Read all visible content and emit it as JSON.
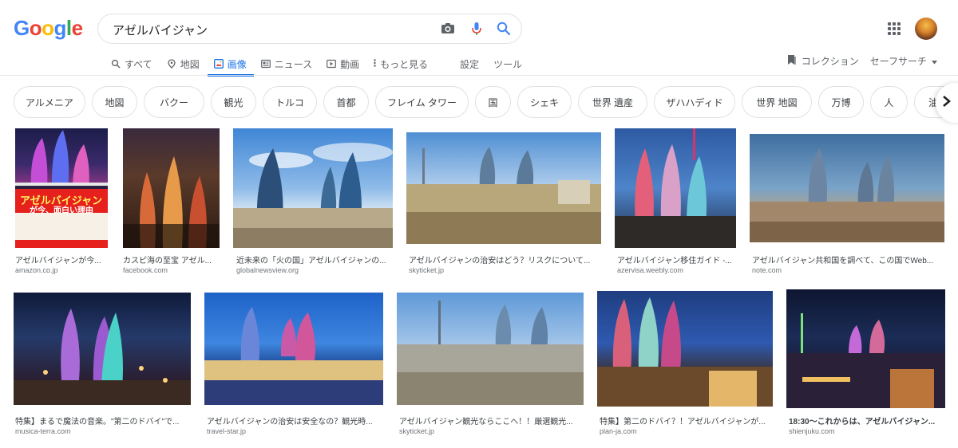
{
  "logo": {
    "letters": [
      "G",
      "o",
      "o",
      "g",
      "l",
      "e"
    ],
    "colors": [
      "#4285F4",
      "#EA4335",
      "#FBBC05",
      "#4285F4",
      "#34A853",
      "#EA4335"
    ]
  },
  "search": {
    "query": "アゼルバイジャン"
  },
  "tabs": [
    {
      "label": "すべて",
      "icon": "search-icon"
    },
    {
      "label": "地図",
      "icon": "map-pin-icon"
    },
    {
      "label": "画像",
      "icon": "image-icon",
      "active": true
    },
    {
      "label": "ニュース",
      "icon": "news-icon"
    },
    {
      "label": "動画",
      "icon": "video-icon"
    },
    {
      "label": "もっと見る",
      "icon": "more-vert-icon"
    },
    {
      "label": "設定"
    },
    {
      "label": "ツール"
    }
  ],
  "right_tools": {
    "collection": "コレクション",
    "safesearch": "セーフサーチ"
  },
  "chips": [
    "アルメニア",
    "地図",
    "バクー",
    "観光",
    "トルコ",
    "首都",
    "フレイム タワー",
    "国",
    "シェキ",
    "世界 遺産",
    "ザハハディド",
    "世界 地図",
    "万博",
    "人",
    "油田"
  ],
  "results": [
    {
      "caption": "アゼルバイジャンが今...",
      "source": "amazon.co.jp"
    },
    {
      "caption": "カスピ海の至宝 アゼル...",
      "source": "facebook.com"
    },
    {
      "caption": "近未来の「火の国」アゼルバイジャンの...",
      "source": "globalnewsview.org"
    },
    {
      "caption": "アゼルバイジャンの治安はどう？リスクについて...",
      "source": "skyticket.jp"
    },
    {
      "caption": "アゼルバイジャン移住ガイド -...",
      "source": "azervisa.weebly.com"
    },
    {
      "caption": "アゼルバイジャン共和国を調べて、この国でWeb...",
      "source": "note.com"
    },
    {
      "caption": "特集】まるで魔法の音楽。\"第二のドバイ\"で...",
      "source": "musica-terra.com"
    },
    {
      "caption": "アゼルバイジャンの治安は安全なの？観光時...",
      "source": "travel-star.jp"
    },
    {
      "caption": "アゼルバイジャン観光ならここへ！！厳選観光...",
      "source": "skyticket.jp"
    },
    {
      "caption": "特集】第二のドバイ？！アゼルバイジャンが...",
      "source": "plan-ja.com"
    },
    {
      "caption": "18:30〜これからは、アゼルバイジャン...",
      "source": "shienjuku.com"
    }
  ],
  "book_cover": {
    "title": "アゼルバイジャン",
    "subtitle": "が今、面白い理由"
  }
}
